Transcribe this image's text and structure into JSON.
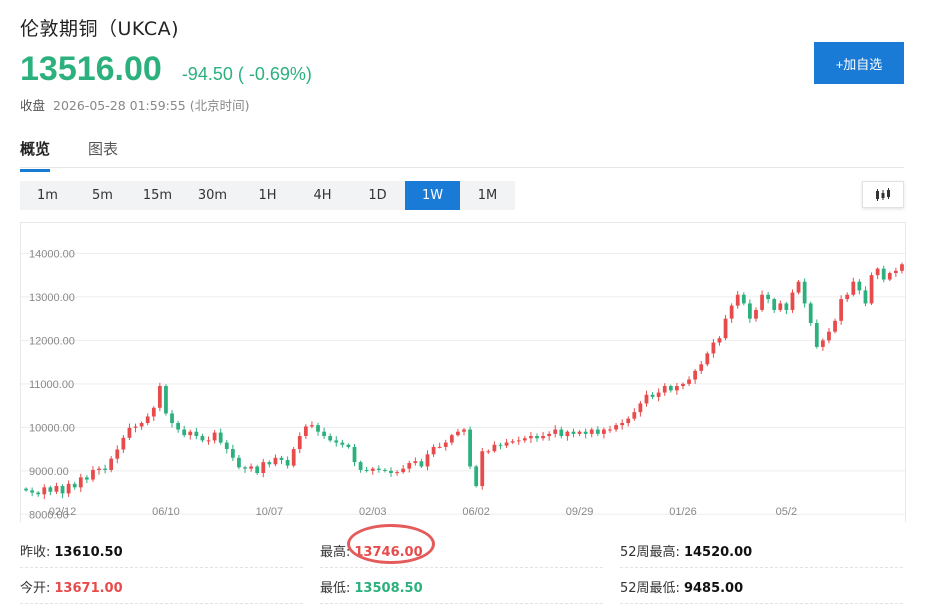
{
  "header": {
    "title": "伦敦期铜（UKCA)",
    "price": "13516.00",
    "change": "-94.50 ( -0.69%)",
    "status_label": "收盘",
    "timestamp": "2026-05-28 01:59:55 (北京时间)",
    "add_button": "+加自选"
  },
  "tabs": [
    "概览",
    "图表"
  ],
  "periods": [
    "1m",
    "5m",
    "15m",
    "30m",
    "1H",
    "4H",
    "1D",
    "1W",
    "1M"
  ],
  "active_period": "1W",
  "colors": {
    "up": "#e84b4b",
    "down": "#2cb07e",
    "accent": "#1a7bd6"
  },
  "stats": {
    "prev_close_label": "昨收:",
    "prev_close": "13610.50",
    "high_label": "最高:",
    "high": "13746.00",
    "week52_high_label": "52周最高:",
    "week52_high": "14520.00",
    "open_label": "今开:",
    "open": "13671.00",
    "low_label": "最低:",
    "low": "13508.50",
    "week52_low_label": "52周最低:",
    "week52_low": "9485.00"
  },
  "chart_data": {
    "type": "candlestick",
    "y_ticks": [
      "14000.00",
      "13000.00",
      "12000.00",
      "11000.00",
      "10000.00",
      "9000.00",
      "8000.00"
    ],
    "y_tick_values": [
      14000,
      13000,
      12000,
      11000,
      10000,
      9000,
      8000
    ],
    "ylim": [
      7800,
      14700
    ],
    "x_ticks": [
      "02/12",
      "06/10",
      "10/07",
      "02/03",
      "06/02",
      "09/29",
      "01/26",
      "05/2"
    ],
    "x_tick_index": [
      6,
      23,
      40,
      57,
      74,
      91,
      108,
      125
    ],
    "n_candles": 126,
    "grid": true,
    "closes": [
      8550,
      8500,
      8460,
      8620,
      8520,
      8650,
      8480,
      8700,
      8620,
      8850,
      8800,
      9020,
      9050,
      9020,
      9280,
      9490,
      9760,
      9990,
      10020,
      10100,
      10250,
      10450,
      10950,
      10320,
      10100,
      9950,
      9820,
      9900,
      9800,
      9700,
      9700,
      9880,
      9650,
      9500,
      9300,
      9080,
      9050,
      9100,
      8950,
      9200,
      9150,
      9300,
      9250,
      9120,
      9500,
      9800,
      10020,
      10050,
      9900,
      9800,
      9700,
      9650,
      9600,
      9550,
      9200,
      9020,
      9000,
      9050,
      9020,
      9000,
      8950,
      8970,
      9050,
      9180,
      9220,
      9100,
      9380,
      9550,
      9550,
      9650,
      9820,
      9900,
      9950,
      9100,
      8650,
      9450,
      9450,
      9600,
      9580,
      9650,
      9680,
      9700,
      9750,
      9800,
      9750,
      9800,
      9850,
      9950,
      9800,
      9900,
      9850,
      9900,
      9850,
      9950,
      9850,
      9950,
      9950,
      10050,
      10100,
      10200,
      10350,
      10550,
      10750,
      10700,
      10800,
      10950,
      10850,
      10950,
      11000,
      11100,
      11300,
      11450,
      11700,
      11950,
      12050,
      12500,
      12800,
      13050,
      12850,
      12500,
      12700,
      13050,
      12950,
      12700,
      12850,
      12700,
      13100,
      13350,
      12850,
      12400,
      11850,
      12000,
      12200,
      12450,
      12950,
      13050,
      13350,
      13150,
      12850,
      13500,
      13650,
      13400,
      13550,
      13600,
      13750
    ]
  }
}
